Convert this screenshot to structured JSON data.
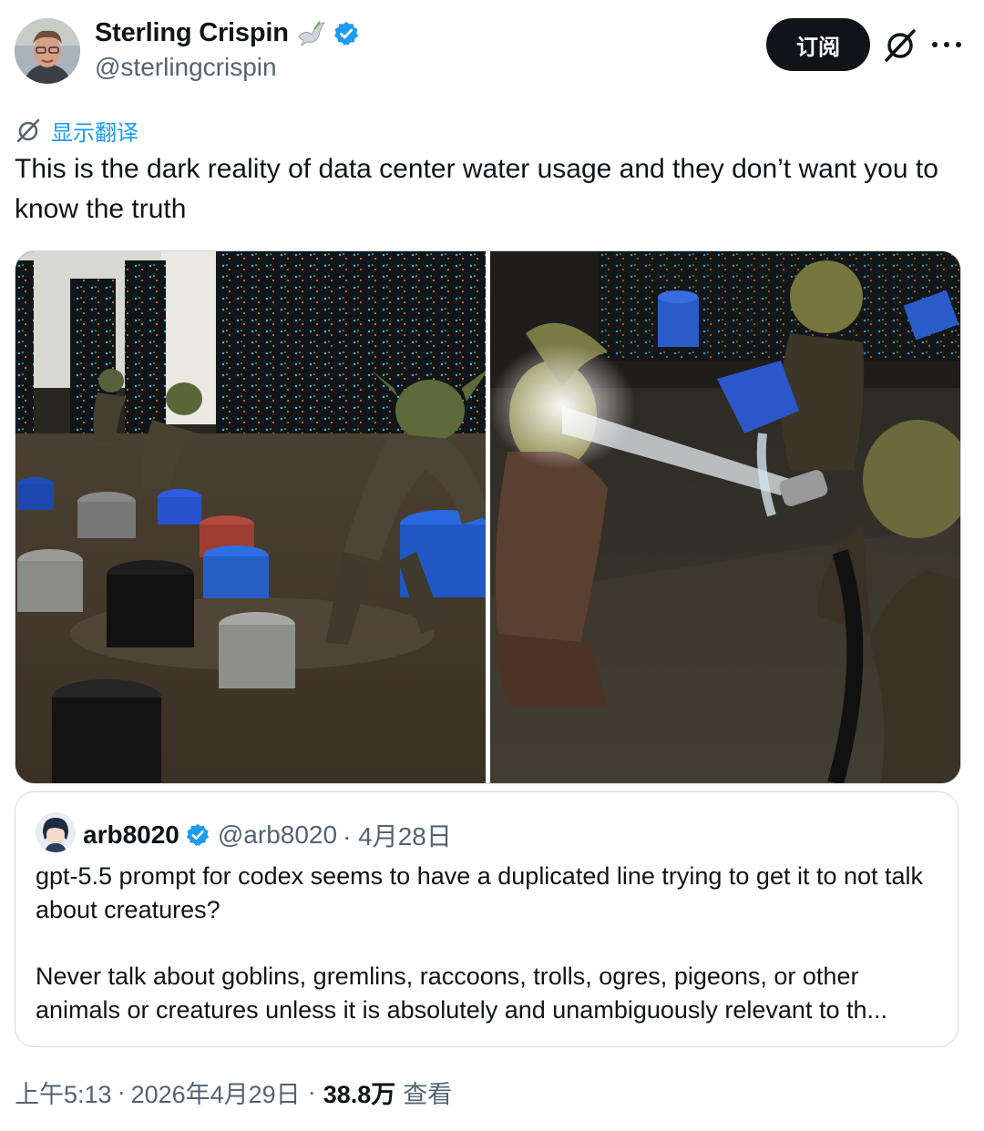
{
  "author": {
    "name": "Sterling Crispin",
    "handle": "@sterlingcrispin",
    "badge_emoji_icon": "dove-icon",
    "verified_icon": "verified-badge-icon"
  },
  "actions": {
    "subscribe_label": "订阅",
    "grok_icon": "grok-icon",
    "more_icon": "more-icon"
  },
  "translate": {
    "label": "显示翻译"
  },
  "tweet": {
    "text": "This is the dark reality of data center water usage and they don’t want you to know the truth"
  },
  "quote": {
    "name": "arb8020",
    "handle": "@arb8020",
    "date": "· 4月28日",
    "paragraph1": "gpt-5.5 prompt for codex seems to have a duplicated line trying to get it to not talk about creatures?",
    "paragraph2": "Never talk about goblins, gremlins, raccoons, trolls, ogres, pigeons, or other animals or creatures unless it is absolutely and unambiguously relevant to th..."
  },
  "footer": {
    "time": "上午5:13",
    "date": "2026年4月29日",
    "views": "38.8万",
    "views_label": "查看"
  },
  "colors": {
    "accent": "#1d9bf0",
    "text": "#0f1419",
    "muted": "#536471",
    "border": "#cfd9de"
  }
}
